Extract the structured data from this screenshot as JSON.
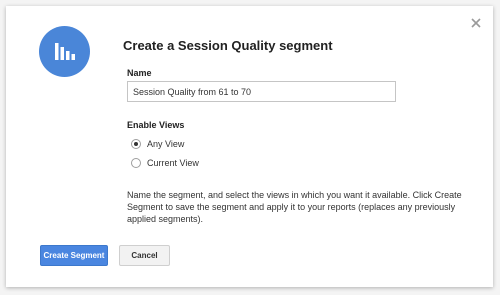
{
  "dialog": {
    "title": "Create a Session Quality segment",
    "name_label": "Name",
    "name_value": "Session Quality from 61 to 70",
    "views_label": "Enable Views",
    "views_options": [
      {
        "label": "Any View",
        "selected": true
      },
      {
        "label": "Current View",
        "selected": false
      }
    ],
    "description": "Name the segment, and select the views in which you want it available. Click Create Segment to save the segment and apply it to your reports (replaces any previously applied segments).",
    "primary_button": "Create Segment",
    "secondary_button": "Cancel",
    "icon": "bar-chart-icon",
    "close_icon": "close-icon"
  },
  "colors": {
    "accent": "#4a86e0",
    "icon_circle": "#4a86d8"
  }
}
